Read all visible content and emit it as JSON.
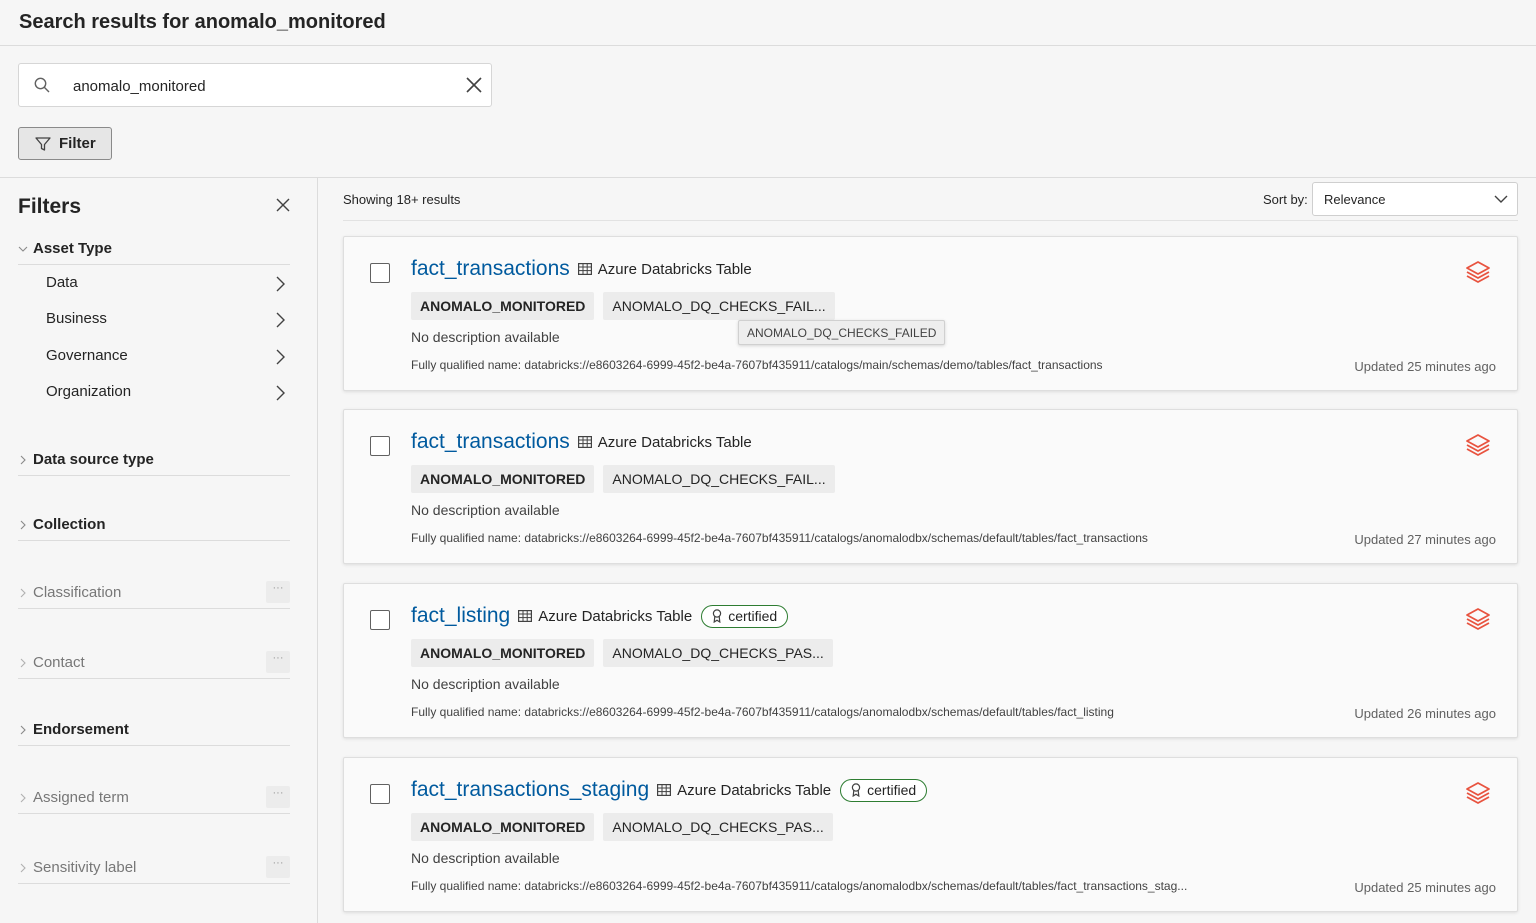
{
  "page": {
    "title": "Search results for anomalo_monitored"
  },
  "search": {
    "value": "anomalo_monitored",
    "placeholder": ""
  },
  "filter_button": {
    "label": "Filter"
  },
  "filters_panel": {
    "title": "Filters",
    "asset_type": {
      "label": "Asset Type",
      "items": [
        "Data",
        "Business",
        "Governance",
        "Organization"
      ]
    },
    "sections": [
      {
        "label": "Data source type"
      },
      {
        "label": "Collection"
      },
      {
        "label": "Classification"
      },
      {
        "label": "Contact"
      },
      {
        "label": "Endorsement"
      },
      {
        "label": "Assigned term"
      },
      {
        "label": "Sensitivity label"
      }
    ]
  },
  "results": {
    "count_text": "Showing 18+ results",
    "sort_label": "Sort by:",
    "sort_value": "Relevance",
    "tooltip": "ANOMALO_DQ_CHECKS_FAILED",
    "items": [
      {
        "title": "fact_transactions",
        "asset_type": "Azure Databricks Table",
        "certified": "",
        "tag1": "ANOMALO_MONITORED",
        "tag2": "ANOMALO_DQ_CHECKS_FAIL...",
        "description": "No description available",
        "fqn": "Fully qualified name: databricks://e8603264-6999-45f2-be4a-7607bf435911/catalogs/main/schemas/demo/tables/fact_transactions",
        "updated": "Updated 25 minutes ago"
      },
      {
        "title": "fact_transactions",
        "asset_type": "Azure Databricks Table",
        "certified": "",
        "tag1": "ANOMALO_MONITORED",
        "tag2": "ANOMALO_DQ_CHECKS_FAIL...",
        "description": "No description available",
        "fqn": "Fully qualified name: databricks://e8603264-6999-45f2-be4a-7607bf435911/catalogs/anomalodbx/schemas/default/tables/fact_transactions",
        "updated": "Updated 27 minutes ago"
      },
      {
        "title": "fact_listing",
        "asset_type": "Azure Databricks Table",
        "certified": "certified",
        "tag1": "ANOMALO_MONITORED",
        "tag2": "ANOMALO_DQ_CHECKS_PAS...",
        "description": "No description available",
        "fqn": "Fully qualified name: databricks://e8603264-6999-45f2-be4a-7607bf435911/catalogs/anomalodbx/schemas/default/tables/fact_listing",
        "updated": "Updated 26 minutes ago"
      },
      {
        "title": "fact_transactions_staging",
        "asset_type": "Azure Databricks Table",
        "certified": "certified",
        "tag1": "ANOMALO_MONITORED",
        "tag2": "ANOMALO_DQ_CHECKS_PAS...",
        "description": "No description available",
        "fqn": "Fully qualified name: databricks://e8603264-6999-45f2-be4a-7607bf435911/catalogs/anomalodbx/schemas/default/tables/fact_transactions_stag...",
        "updated": "Updated 25 minutes ago"
      }
    ]
  },
  "colors": {
    "link": "#005a9e",
    "databricks": "#e8533f",
    "certified_border": "#2e7d32"
  },
  "icons": {
    "search": "search-icon",
    "clear": "close-icon",
    "filter": "funnel-icon",
    "table": "table-icon",
    "databricks": "databricks-stack-icon",
    "certified": "ribbon-icon"
  }
}
